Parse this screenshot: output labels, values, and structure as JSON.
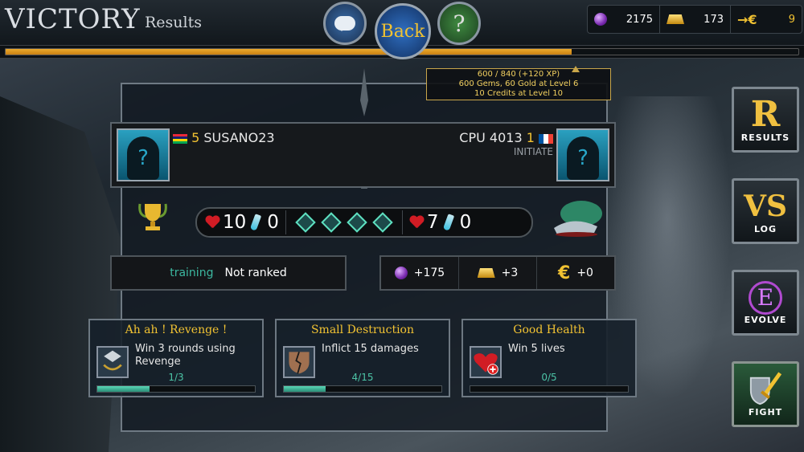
{
  "header": {
    "title": "VICTORY",
    "subtitle": "Results"
  },
  "nav": {
    "back_label": "Back",
    "help_label": "?"
  },
  "resources": {
    "gems": "2175",
    "gold": "173",
    "credits": "9"
  },
  "xp": {
    "progress": 0.714,
    "tooltip_line1": "600 / 840 (+120 XP)",
    "tooltip_line2": "600 Gems, 60 Gold at Level 6",
    "tooltip_line3": "10 Credits at Level 10"
  },
  "player_left": {
    "level": "5",
    "name": "SUSANO23",
    "flag": "mauritius"
  },
  "player_right": {
    "name": "CPU 4013",
    "level": "1",
    "rank": "INITIATE",
    "flag": "france"
  },
  "score": {
    "left_lives": "10",
    "left_potions": "0",
    "right_lives": "7",
    "right_potions": "0",
    "rounds_won": 4
  },
  "ranking": {
    "mode": "training",
    "status": "Not ranked"
  },
  "rewards": {
    "gems": "+175",
    "gold": "+3",
    "credits": "+0"
  },
  "quests": [
    {
      "title": "Ah ah ! Revenge !",
      "desc": "Win 3 rounds using Revenge",
      "progress": "1/3",
      "fraction": 0.333
    },
    {
      "title": "Small Destruction",
      "desc": "Inflict 15 damages",
      "progress": "4/15",
      "fraction": 0.267
    },
    {
      "title": "Good Health",
      "desc": "Win 5 lives",
      "progress": "0/5",
      "fraction": 0
    }
  ],
  "sidebar": [
    {
      "glyph": "R",
      "label": "RESULTS"
    },
    {
      "glyph": "VS",
      "label": "LOG"
    },
    {
      "glyph": "E",
      "label": "EVOLVE"
    },
    {
      "glyph": "",
      "label": "FIGHT"
    }
  ],
  "colors": {
    "accent_gold": "#f1c232",
    "teal": "#3cb8a0",
    "xp_orange": "#e8a020"
  }
}
